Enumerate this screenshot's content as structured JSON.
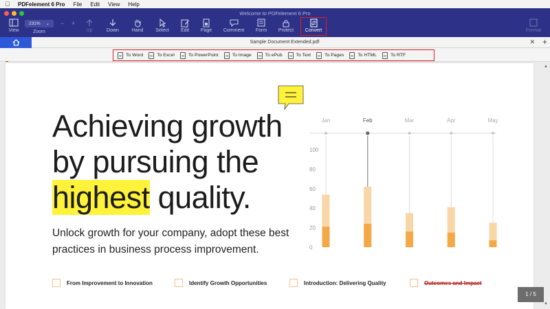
{
  "menubar": {
    "app_name": "PDFelement 6 Pro",
    "items": [
      "File",
      "Edit",
      "View",
      "Help"
    ]
  },
  "window": {
    "title": "Welcome to PDFelement 6 Pro"
  },
  "toolbar": {
    "zoom_value": "231%",
    "zoom_label": "Zoom",
    "tools": [
      {
        "label": "View",
        "icon": "view-icon"
      },
      {
        "label": "Up",
        "icon": "up-icon"
      },
      {
        "label": "Down",
        "icon": "down-icon"
      },
      {
        "label": "Hand",
        "icon": "hand-icon"
      },
      {
        "label": "Select",
        "icon": "select-icon"
      },
      {
        "label": "Edit",
        "icon": "edit-icon"
      },
      {
        "label": "Page",
        "icon": "page-icon"
      },
      {
        "label": "Comment",
        "icon": "comment-icon"
      },
      {
        "label": "Form",
        "icon": "form-icon"
      },
      {
        "label": "Protect",
        "icon": "protect-icon"
      },
      {
        "label": "Convert",
        "icon": "convert-icon"
      },
      {
        "label": "Format",
        "icon": "format-icon"
      }
    ]
  },
  "tabs": {
    "document_tab": "Sample Document Extended.pdf"
  },
  "convert_options": [
    "To Word",
    "To Excel",
    "To PowerPoint",
    "To Image",
    "To ePub",
    "To Text",
    "To Pages",
    "To HTML",
    "To RTF"
  ],
  "document": {
    "headline_line1": "Achieving growth",
    "headline_line2": "by pursuing the",
    "headline_highlight": "highest",
    "headline_rest": " quality.",
    "subheading": "Unlock growth for your company, adopt these best practices in business process improvement.",
    "features": [
      "From Improvement to Innovation",
      "Identify Growth Opportunities",
      "Introduction: Delivering Quality",
      "Outcomes and Impact"
    ]
  },
  "pager": "1 / 5",
  "colors": {
    "toolbar_bg": "#2d3187",
    "highlight": "#fff23a",
    "bar_light": "#f9d6a8",
    "bar_dark": "#f3a947",
    "convert_outline": "#e02020"
  },
  "chart_data": {
    "type": "bar",
    "categories": [
      "Jan",
      "Feb",
      "Mar",
      "Apr",
      "May"
    ],
    "ylim": [
      0,
      100
    ],
    "yticks": [
      "100",
      "80",
      "60",
      "40",
      "20",
      "0"
    ],
    "highlighted_category": "Feb",
    "series": [
      {
        "values": [
          54,
          62,
          35,
          41,
          25
        ]
      },
      {
        "values": [
          21,
          24,
          16,
          15,
          7
        ]
      }
    ]
  }
}
